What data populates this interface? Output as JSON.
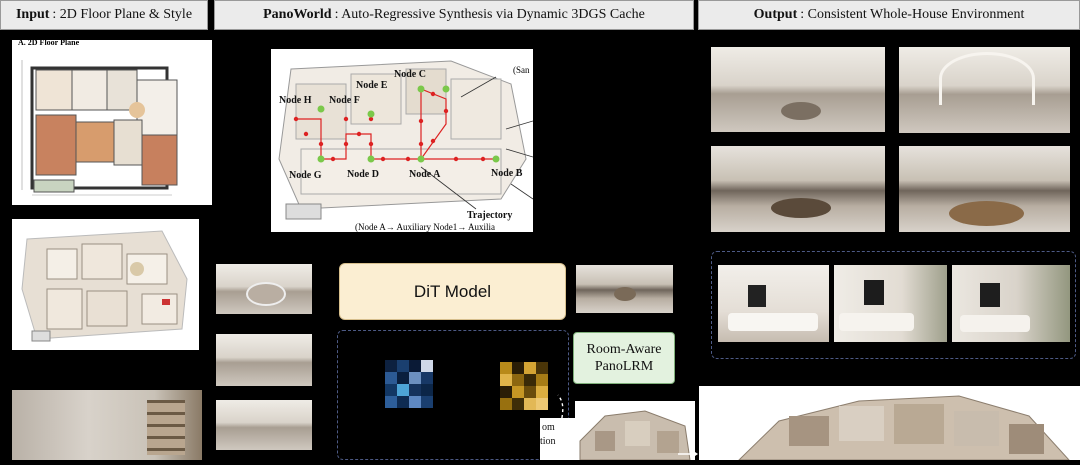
{
  "headers": {
    "input": {
      "bold": "Input",
      "rest": ": 2D Floor Plane & Style"
    },
    "panoworld": {
      "bold": "PanoWorld",
      "rest": ": Auto-Regressive Synthesis via Dynamic 3DGS Cache"
    },
    "output": {
      "bold": "Output",
      "rest": ": Consistent Whole-House Environment"
    }
  },
  "floorplan": {
    "title": "A. 2D Floor Plane"
  },
  "trajectory_figure": {
    "nodes": [
      "Node H",
      "Node F",
      "Node E",
      "Node C",
      "Node G",
      "Node D",
      "Node A",
      "Node B"
    ],
    "label_trajectory": "Trajectory",
    "label_sequence": "(Node A→ Auxiliary Node1→ Auxilia",
    "label_sample": "(San"
  },
  "dit_model": {
    "label": "DiT Model"
  },
  "room_aware": {
    "line1": "Room-Aware",
    "line2": "PanoLRM"
  },
  "fragments": {
    "line1": "om",
    "line2": "tion"
  }
}
